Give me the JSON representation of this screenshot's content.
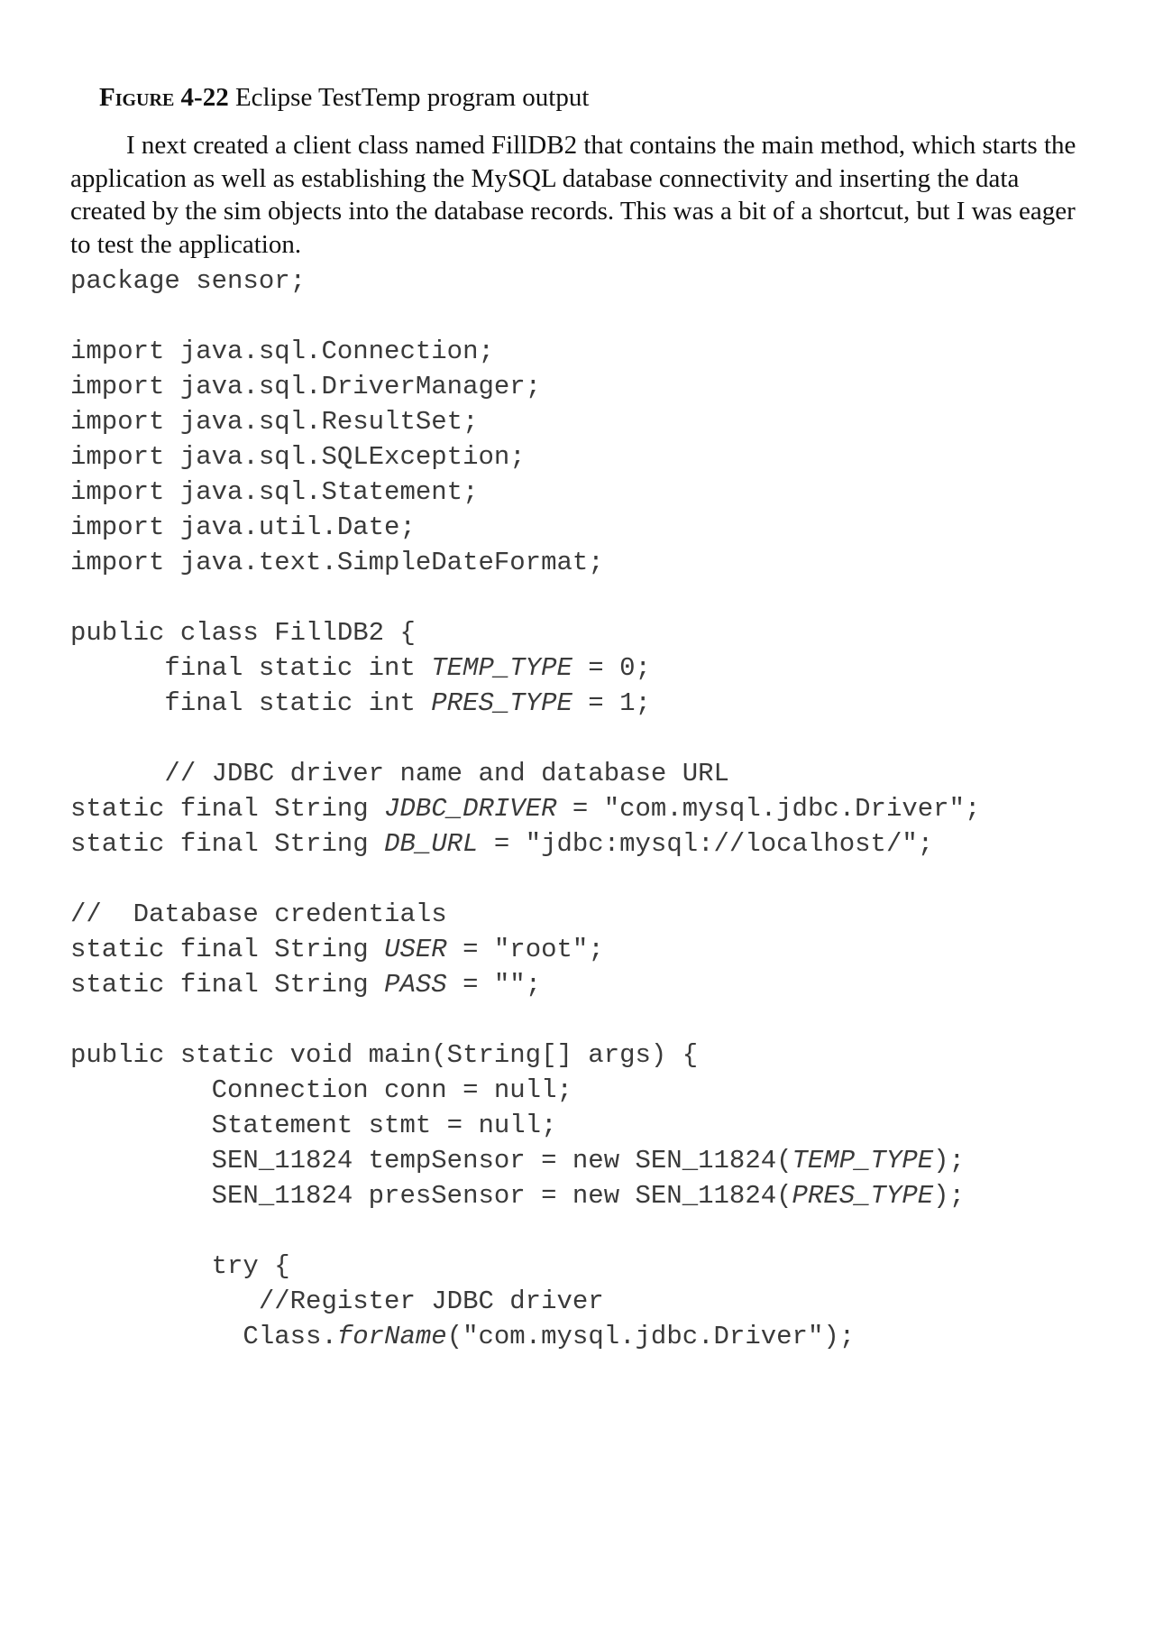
{
  "caption": {
    "figure_label": "Figure",
    "figure_number": "4-22",
    "text": " Eclipse TestTemp program output"
  },
  "paragraph": "I next created a client class named FillDB2 that contains the main method, which starts the application as well as establishing the MySQL database connectivity and inserting the data created by the sim objects into the database records. This was a bit of a shortcut, but I was eager to test the application.",
  "code": {
    "lines": [
      "package sensor;",
      "",
      "import java.sql.Connection;",
      "import java.sql.DriverManager;",
      "import java.sql.ResultSet;",
      "import java.sql.SQLException;",
      "import java.sql.Statement;",
      "import java.util.Date;",
      "import java.text.SimpleDateFormat;",
      "",
      "public class FillDB2 {",
      "      final static int TEMP_TYPE = 0;",
      "      final static int PRES_TYPE = 1;",
      "",
      "      // JDBC driver name and database URL",
      "static final String JDBC_DRIVER = \"com.mysql.jdbc.Driver\";",
      "static final String DB_URL = \"jdbc:mysql://localhost/\";",
      "",
      "//  Database credentials",
      "static final String USER = \"root\";",
      "static final String PASS = \"\";",
      "",
      "public static void main(String[] args) {",
      "         Connection conn = null;",
      "         Statement stmt = null;",
      "         SEN_11824 tempSensor = new SEN_11824(TEMP_TYPE);",
      "         SEN_11824 presSensor = new SEN_11824(PRES_TYPE);",
      "",
      "         try {",
      "            //Register JDBC driver",
      "           Class.forName(\"com.mysql.jdbc.Driver\");"
    ]
  }
}
